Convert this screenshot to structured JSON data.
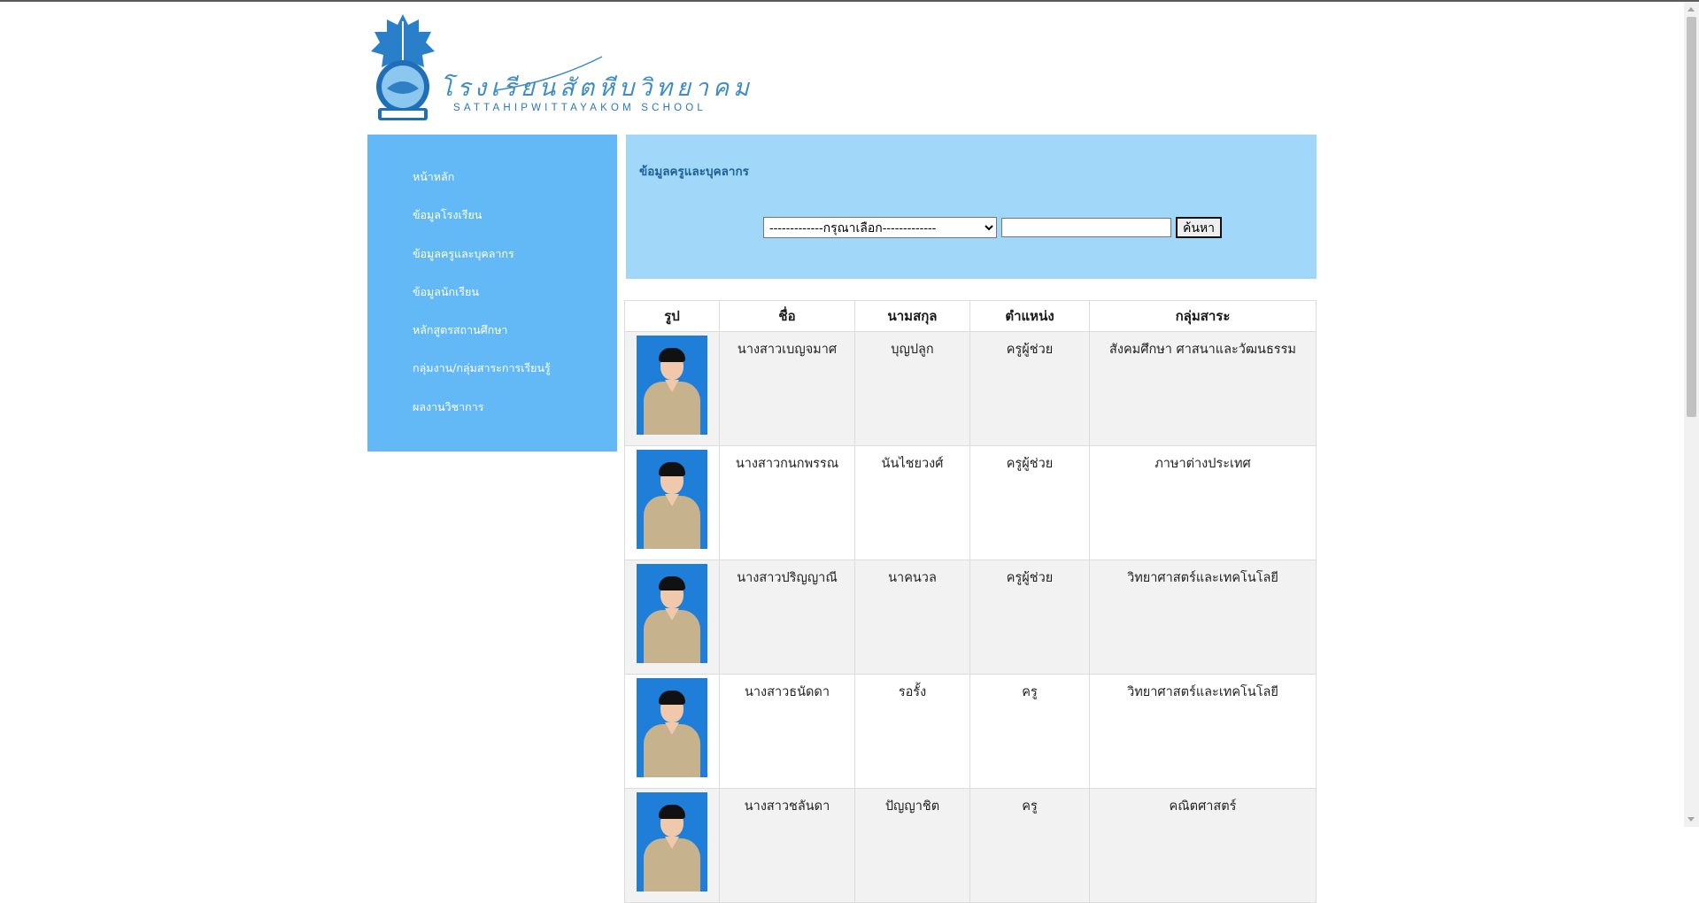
{
  "header": {
    "school_name_th": "โรงเรียนสัตหีบวิทยาคม",
    "school_name_en": "SATTAHIPWITTAYAKOM SCHOOL"
  },
  "sidebar": {
    "items": [
      {
        "label": "หน้าหลัก"
      },
      {
        "label": "ข้อมูลโรงเรียน"
      },
      {
        "label": "ข้อมูลครูและบุคลากร"
      },
      {
        "label": "ข้อมูลนักเรียน"
      },
      {
        "label": "หลักสูตรสถานศึกษา"
      },
      {
        "label": "กลุ่มงาน/กลุ่มสาระการเรียนรู้"
      },
      {
        "label": "ผลงานวิชาการ"
      }
    ]
  },
  "panel": {
    "title": "ข้อมูลครูและบุคลากร",
    "select_value": "-------------กรุณาเลือก-------------",
    "search_value": "",
    "search_button": "ค้นหา"
  },
  "table": {
    "headers": [
      "รูป",
      "ชื่อ",
      "นามสกุล",
      "ตำแหน่ง",
      "กลุ่มสาระ"
    ],
    "rows": [
      {
        "first": "นางสาวเบญจมาศ",
        "last": "บุญปลูก",
        "position": "ครูผู้ช่วย",
        "group": "สังคมศึกษา ศาสนาและวัฒนธรรม"
      },
      {
        "first": "นางสาวกนกพรรณ",
        "last": "นันไชยวงศ์",
        "position": "ครูผู้ช่วย",
        "group": "ภาษาต่างประเทศ"
      },
      {
        "first": "นางสาวปริญญาณี",
        "last": "นาคนวล",
        "position": "ครูผู้ช่วย",
        "group": "วิทยาศาสตร์และเทคโนโลยี"
      },
      {
        "first": "นางสาวธนัดดา",
        "last": "รอรั้ง",
        "position": "ครู",
        "group": "วิทยาศาสตร์และเทคโนโลยี"
      },
      {
        "first": "นางสาวชลันดา",
        "last": "ปัญญาชิต",
        "position": "ครู",
        "group": "คณิตศาสตร์"
      }
    ]
  },
  "colors": {
    "sidebar_bg": "#63b9f5",
    "panel_bg": "#a1d7f8",
    "panel_title": "#1e6199",
    "row_alt": "#f2f2f2"
  }
}
